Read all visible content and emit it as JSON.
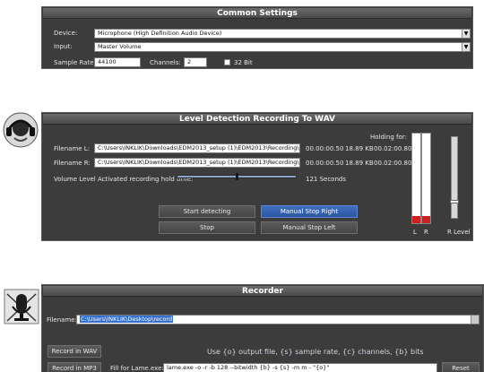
{
  "common": {
    "title": "Common Settings",
    "device_label": "Device:",
    "device_value": "Microphone (High Definition Audio Device)",
    "input_label": "Input:",
    "input_value": "Master Volume",
    "rate_label": "Sample Rate:",
    "rate_value": "44100",
    "channels_label": "Channels:",
    "channels_value": "2",
    "bit32_label": "32 Bit"
  },
  "level": {
    "title": "Level Detection Recording To WAV",
    "holding_label": "Holding for:",
    "filename_l_label": "Filename L:",
    "filename_l_value": "C:\\Users\\INKLIK\\Downloads\\EDM2013_setup (1)\\EDM2013\\Recording\\Record",
    "filename_l_time": "00.00:00.50",
    "filename_l_size": "18.89 KB",
    "filename_l_hold": "00.02:00.80",
    "filename_r_label": "Filename R:",
    "filename_r_value": "C:\\Users\\INKLIK\\Downloads\\EDM2013_setup (1)\\EDM2013\\Recording\\Record",
    "filename_r_time": "00.00:00.50",
    "filename_r_size": "18.89 KB",
    "filename_r_hold": "00.02:00.80",
    "hold_time_label": "Volume Level Activated recording hold time:",
    "hold_time_value": "121 Seconds",
    "btn_start": "Start detecting",
    "btn_stop": "Stop",
    "btn_manual_right": "Manual Stop Right",
    "btn_manual_left": "Manual Stop Left",
    "meter_l_label": "L",
    "meter_r_label": "R",
    "r_level_label": "R Level"
  },
  "recorder": {
    "title": "Recorder",
    "filename_label": "Filename:",
    "filename_value": "C:\\Users\\INKLIK\\Desktop\\record",
    "btn_wav": "Record in WAV",
    "btn_mp3": "Record in MP3",
    "hint": "Use {o} output file, {s} sample rate, {c} channels, {b} bits",
    "lame_label": "Fill for Lame.exe:",
    "lame_value": "lame.exe -o -r -b 128 --bitwidth {b} -s {s} -m m - \"{o}\"",
    "btn_reset": "Reset"
  }
}
